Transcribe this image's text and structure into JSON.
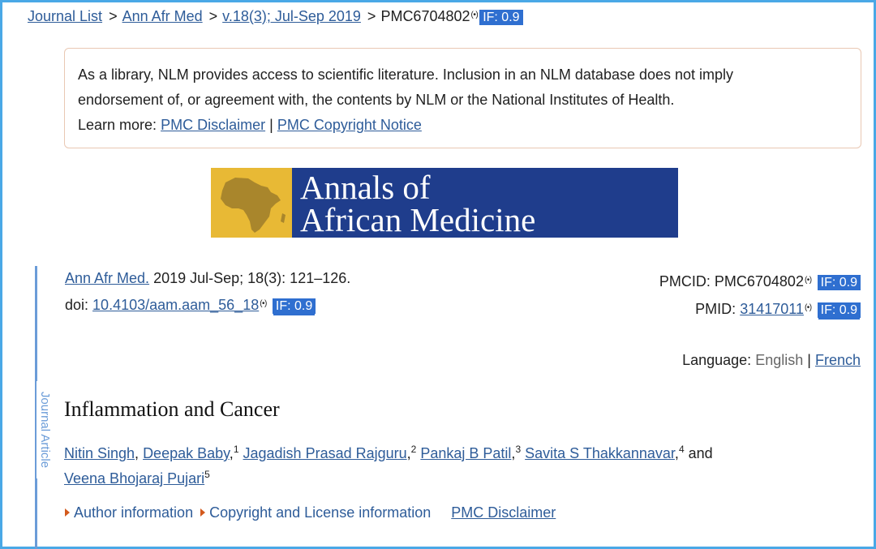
{
  "breadcrumb": {
    "items": [
      "Journal List",
      "Ann Afr Med",
      "v.18(3); Jul-Sep 2019"
    ],
    "current": "PMC6704802",
    "separator": ">",
    "if_badge": "IF: 0.9"
  },
  "disclaimer": {
    "line1": "As a library, NLM provides access to scientific literature. Inclusion in an NLM database does not imply",
    "line2": "endorsement of, or agreement with, the contents by NLM or the National Institutes of Health.",
    "learn_more": "Learn more:",
    "link1": "PMC Disclaimer",
    "divider": "|",
    "link2": "PMC Copyright Notice"
  },
  "banner": {
    "line1": "Annals of",
    "line2": "African Medicine"
  },
  "sidebar": {
    "label": "Journal Article"
  },
  "citation": {
    "journal_link": "Ann Afr Med.",
    "details": "2019 Jul-Sep; 18(3): 121–126.",
    "doi_label": "doi:",
    "doi_link": "10.4103/aam.aam_56_18",
    "doi_if": "IF: 0.9"
  },
  "ids": {
    "pmcid_label": "PMCID:",
    "pmcid": "PMC6704802",
    "pmcid_if": "IF: 0.9",
    "pmid_label": "PMID:",
    "pmid": "31417011",
    "pmid_if": "IF: 0.9"
  },
  "language": {
    "label": "Language:",
    "current": "English",
    "divider": "|",
    "other": "French"
  },
  "article": {
    "title": "Inflammation and Cancer",
    "authors": [
      {
        "name": "Nitin Singh",
        "sup": ""
      },
      {
        "name": "Deepak Baby",
        "sup": "1"
      },
      {
        "name": "Jagadish Prasad Rajguru",
        "sup": "2"
      },
      {
        "name": "Pankaj B Patil",
        "sup": "3"
      },
      {
        "name": "Savita S Thakkannavar",
        "sup": "4"
      },
      {
        "name": "Veena Bhojaraj Pujari",
        "sup": "5"
      }
    ],
    "and_word": "and"
  },
  "sections": {
    "author_info": "Author information",
    "copyright": "Copyright and License information",
    "disclaimer": "PMC Disclaimer"
  },
  "colors": {
    "link": "#2e5c99",
    "badge": "#2f6fd0",
    "frame": "#4aa8e6",
    "banner_blue": "#1f3d8c",
    "banner_gold": "#e8b935",
    "triangle": "#d35a1d"
  },
  "icons": {
    "rss": "rss-icon",
    "expand": "triangle-right-icon"
  }
}
